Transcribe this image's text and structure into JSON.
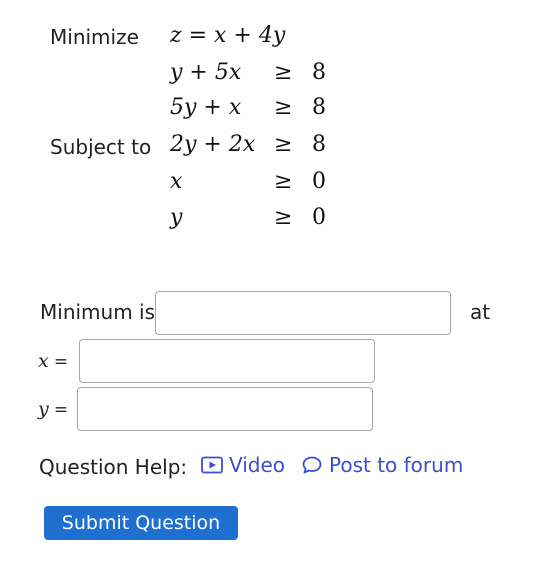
{
  "problem": {
    "minimize_label": "Minimize",
    "objective": "z = x + 4y",
    "subject_to_label": "Subject to",
    "constraints": [
      {
        "lhs": "y + 5x",
        "op": "≥",
        "rhs": "8"
      },
      {
        "lhs": "5y + x",
        "op": "≥",
        "rhs": "8"
      },
      {
        "lhs": "2y + 2x",
        "op": "≥",
        "rhs": "8"
      },
      {
        "lhs": "x",
        "op": "≥",
        "rhs": "0"
      },
      {
        "lhs": "y",
        "op": "≥",
        "rhs": "0"
      }
    ]
  },
  "answer": {
    "minimum_label": "Minimum is",
    "at_label": "at",
    "x_label": "x",
    "y_label": "y",
    "equals": "=",
    "minimum_value": "",
    "x_value": "",
    "y_value": ""
  },
  "help": {
    "label": "Question Help:",
    "video_label": "Video",
    "video_icon": "play-video-icon",
    "forum_label": "Post to forum",
    "forum_icon": "speech-bubble-icon"
  },
  "submit": {
    "label": "Submit Question"
  },
  "colors": {
    "link": "#3b4fcf",
    "button": "#1f6fd0",
    "border": "#a8a8a8"
  }
}
